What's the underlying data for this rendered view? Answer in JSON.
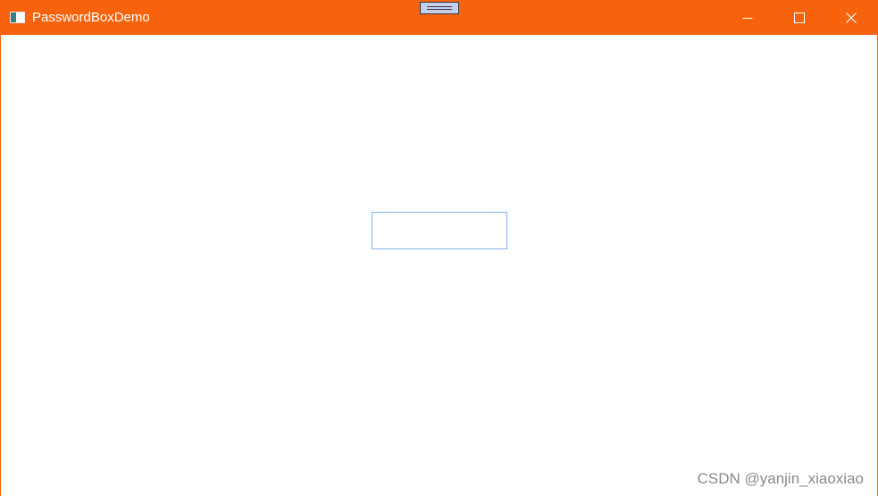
{
  "window": {
    "title": "PasswordBoxDemo",
    "accent_color": "#f7630c",
    "app_icon": "window-app-icon"
  },
  "controls": {
    "minimize_icon": "minimize-icon",
    "maximize_icon": "maximize-icon",
    "close_icon": "close-icon"
  },
  "password_box": {
    "value": "",
    "border_color": "#7eb4ea"
  },
  "watermark": {
    "text": "CSDN @yanjin_xiaoxiao"
  }
}
